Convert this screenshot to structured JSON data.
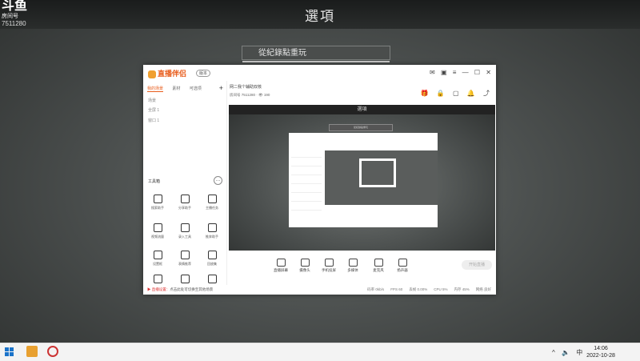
{
  "background": {
    "streamer_logo": "斗鱼",
    "room_label": "房间号",
    "room_number": "7511280",
    "dialog_title": "選項",
    "replay_label": "從紀錄點重玩"
  },
  "app": {
    "brand": "直播伴侣",
    "version_badge": "版本",
    "tabs": [
      "我的场景",
      "素材",
      "可选项"
    ],
    "scenes": [
      "场景",
      "全屏 1",
      "窗口 1"
    ],
    "tools_title": "工具箱",
    "tools": [
      "搜索助手",
      "分享助手",
      "主播任务",
      "视频流量",
      "录入工具",
      "推奔助手",
      "设置框",
      "表情推荐",
      "回放集",
      "",
      "",
      ""
    ],
    "stream_title": "网二我个辅助双核",
    "category_label": "房间号",
    "category_value": "7511280",
    "viewers": "190",
    "streamer_label": "直播",
    "controls": [
      "直播屏幕",
      "摄像头",
      "手机投屏",
      "多媒体",
      "麦克风",
      "扬声器"
    ],
    "go_live": "开始直播",
    "warning_prefix": "直播设置：",
    "warning_text": "点击此处可切换至其他场景",
    "stats": [
      "码率 0kb/s",
      "FPS 60",
      "丢帧 0.00%",
      "CPU 5%",
      "内存 45%",
      "网络 良好"
    ],
    "preview_title": "選項",
    "preview_replay": "從紀錄點重玩"
  },
  "taskbar": {
    "time": "14:06",
    "date": "2022-10-28",
    "ime": "中"
  },
  "colors": {
    "accent": "#e85c1b",
    "windows_blue": "#1a73c9"
  }
}
